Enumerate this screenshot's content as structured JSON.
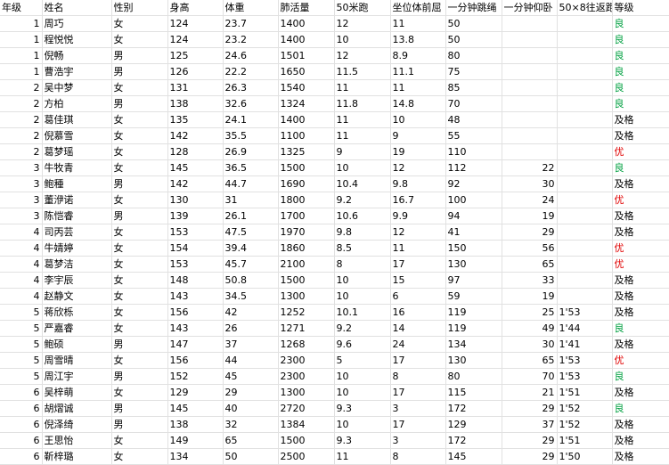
{
  "headers": [
    "年级",
    "姓名",
    "性别",
    "身高",
    "体重",
    "肺活量",
    "50米跑",
    "坐位体前屈",
    "一分钟跳绳",
    "一分钟仰卧",
    "50×8往返跑",
    "等级"
  ],
  "rows": [
    [
      "1",
      "周巧",
      "女",
      "124",
      "23.7",
      "1400",
      "12",
      "11",
      "50",
      "",
      "",
      "良"
    ],
    [
      "1",
      "程悦悦",
      "女",
      "124",
      "23.2",
      "1400",
      "10",
      "13.8",
      "50",
      "",
      "",
      "良"
    ],
    [
      "1",
      "倪畅",
      "男",
      "125",
      "24.6",
      "1501",
      "12",
      "8.9",
      "80",
      "",
      "",
      "良"
    ],
    [
      "1",
      "曹浩宇",
      "男",
      "126",
      "22.2",
      "1650",
      "11.5",
      "11.1",
      "75",
      "",
      "",
      "良"
    ],
    [
      "2",
      "吴中梦",
      "女",
      "131",
      "26.3",
      "1540",
      "11",
      "11",
      "85",
      "",
      "",
      "良"
    ],
    [
      "2",
      "方柏",
      "男",
      "138",
      "32.6",
      "1324",
      "11.8",
      "14.8",
      "70",
      "",
      "",
      "良"
    ],
    [
      "2",
      "葛佳琪",
      "女",
      "135",
      "24.1",
      "1400",
      "11",
      "10",
      "48",
      "",
      "",
      "及格"
    ],
    [
      "2",
      "倪慕雪",
      "女",
      "142",
      "35.5",
      "1100",
      "11",
      "9",
      "55",
      "",
      "",
      "及格"
    ],
    [
      "2",
      "葛梦瑶",
      "女",
      "128",
      "26.9",
      "1325",
      "9",
      "19",
      "110",
      "",
      "",
      "优"
    ],
    [
      "3",
      "牛牧青",
      "女",
      "145",
      "36.5",
      "1500",
      "10",
      "12",
      "112",
      "22",
      "",
      "良"
    ],
    [
      "3",
      "鲍種",
      "男",
      "142",
      "44.7",
      "1690",
      "10.4",
      "9.8",
      "92",
      "30",
      "",
      "及格"
    ],
    [
      "3",
      "董洢诺",
      "女",
      "130",
      "31",
      "1800",
      "9.2",
      "16.7",
      "100",
      "24",
      "",
      "优"
    ],
    [
      "3",
      "陈恺睿",
      "男",
      "139",
      "26.1",
      "1700",
      "10.6",
      "9.9",
      "94",
      "19",
      "",
      "及格"
    ],
    [
      "4",
      "司丙芸",
      "女",
      "153",
      "47.5",
      "1970",
      "9.8",
      "12",
      "41",
      "29",
      "",
      "及格"
    ],
    [
      "4",
      "牛婧婷",
      "女",
      "154",
      "39.4",
      "1860",
      "8.5",
      "11",
      "150",
      "56",
      "",
      "优"
    ],
    [
      "4",
      "葛梦洁",
      "女",
      "153",
      "45.7",
      "2100",
      "8",
      "17",
      "130",
      "65",
      "",
      "优"
    ],
    [
      "4",
      "李宇辰",
      "女",
      "148",
      "50.8",
      "1500",
      "10",
      "15",
      "97",
      "33",
      "",
      "及格"
    ],
    [
      "4",
      "赵静文",
      "女",
      "143",
      "34.5",
      "1300",
      "10",
      "6",
      "59",
      "19",
      "",
      "及格"
    ],
    [
      "5",
      "蒋欣栎",
      "女",
      "156",
      "42",
      "1252",
      "10.1",
      "16",
      "119",
      "25",
      "1'53",
      "及格"
    ],
    [
      "5",
      "严嘉睿",
      "女",
      "143",
      "26",
      "1271",
      "9.2",
      "14",
      "119",
      "49",
      "1'44",
      "良"
    ],
    [
      "5",
      "鲍硕",
      "男",
      "147",
      "37",
      "1268",
      "9.6",
      "24",
      "134",
      "30",
      "1'41",
      "及格"
    ],
    [
      "5",
      "周雪晴",
      "女",
      "156",
      "44",
      "2300",
      "5",
      "17",
      "130",
      "65",
      "1'53",
      "优"
    ],
    [
      "5",
      "周江宇",
      "男",
      "152",
      "45",
      "2300",
      "10",
      "8",
      "80",
      "70",
      "1'53",
      "良"
    ],
    [
      "6",
      "吴梓萌",
      "女",
      "129",
      "29",
      "1300",
      "10",
      "17",
      "115",
      "21",
      "1'51",
      "及格"
    ],
    [
      "6",
      "胡熠诚",
      "男",
      "145",
      "40",
      "2720",
      "9.3",
      "3",
      "172",
      "29",
      "1'52",
      "良"
    ],
    [
      "6",
      "倪泽绮",
      "男",
      "138",
      "32",
      "1384",
      "10",
      "17",
      "129",
      "37",
      "1'52",
      "及格"
    ],
    [
      "6",
      "王思怡",
      "女",
      "149",
      "65",
      "1500",
      "9.3",
      "3",
      "172",
      "29",
      "1'51",
      "及格"
    ],
    [
      "6",
      "靳梓璐",
      "女",
      "134",
      "50",
      "2500",
      "11",
      "8",
      "145",
      "29",
      "1'50",
      "及格"
    ]
  ],
  "grade_colors": {
    "及格": "#000000",
    "良": "#00a040",
    "优": "#e00000"
  }
}
